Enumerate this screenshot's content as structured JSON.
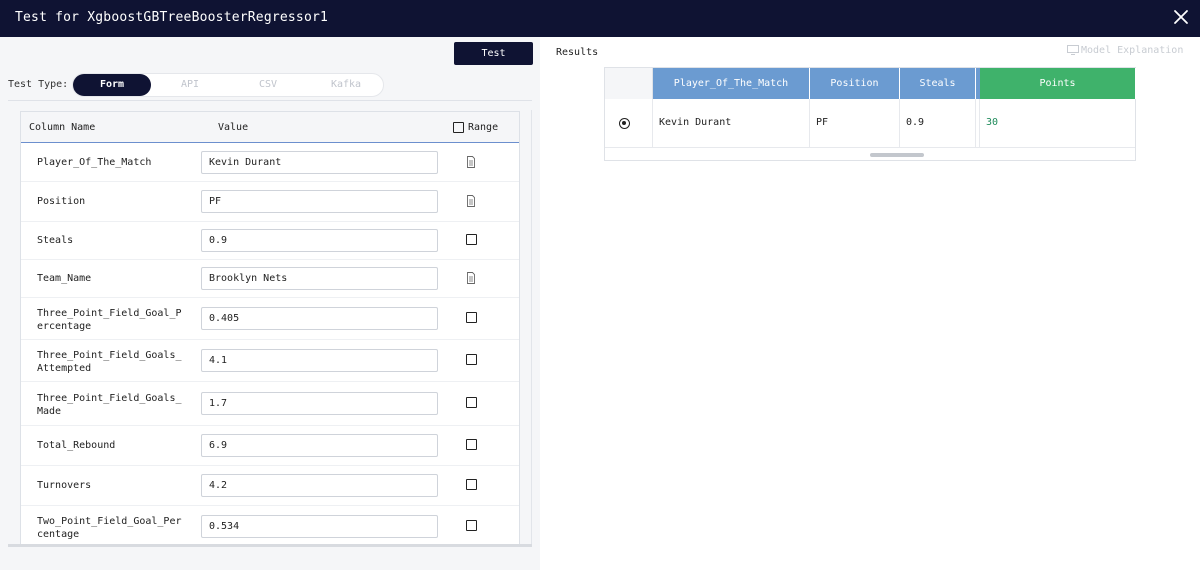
{
  "window": {
    "title": "Test for XgboostGBTreeBoosterRegressor1"
  },
  "toolbar": {
    "test_label": "Test"
  },
  "test_type": {
    "label": "Test Type:",
    "options": [
      "Form",
      "API",
      "CSV",
      "Kafka"
    ],
    "selected": "Form"
  },
  "form": {
    "headers": {
      "column_name": "Column Name",
      "value": "Value",
      "range": "Range"
    },
    "rows": [
      {
        "name": "Player_Of_The_Match",
        "value": "Kevin Durant",
        "icon": "document-icon"
      },
      {
        "name": "Position",
        "value": "PF",
        "icon": "document-icon"
      },
      {
        "name": "Steals",
        "value": "0.9",
        "icon": "checkbox"
      },
      {
        "name": "Team_Name",
        "value": "Brooklyn Nets",
        "icon": "document-icon"
      },
      {
        "name": "Three_Point_Field_Goal_Percentage",
        "value": "0.405",
        "icon": "checkbox"
      },
      {
        "name": "Three_Point_Field_Goals_Attempted",
        "value": "4.1",
        "icon": "checkbox"
      },
      {
        "name": "Three_Point_Field_Goals_Made",
        "value": "1.7",
        "icon": "checkbox"
      },
      {
        "name": "Total_Rebound",
        "value": "6.9",
        "icon": "checkbox"
      },
      {
        "name": "Turnovers",
        "value": "4.2",
        "icon": "checkbox"
      },
      {
        "name": "Two_Point_Field_Goal_Percentage",
        "value": "0.534",
        "icon": "checkbox"
      }
    ]
  },
  "results": {
    "label": "Results",
    "model_explanation": "Model Explanation",
    "columns": [
      "Player_Of_The_Match",
      "Position",
      "Steals",
      "Points"
    ],
    "row": {
      "Player_Of_The_Match": "Kevin Durant",
      "Position": "PF",
      "Steals": "0.9",
      "Points": "30"
    }
  },
  "colors": {
    "titlebar": "#0f1333",
    "header_blue": "#6b9bd1",
    "header_green": "#3fb26b",
    "points_text": "#1e8a5a"
  }
}
